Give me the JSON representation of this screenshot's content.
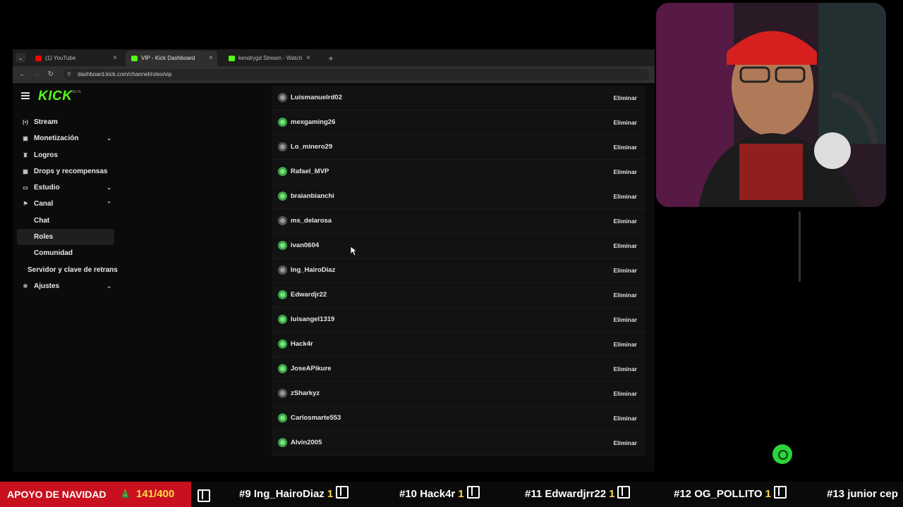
{
  "browser": {
    "tabs": [
      {
        "label": "(1) YouTube",
        "close": "×",
        "favicon_color": "#ff0000"
      },
      {
        "label": "VIP - Kick Dashboard",
        "close": "×",
        "favicon_color": "#53fc18",
        "active": true
      },
      {
        "label": "kendrygd Stream - Watch Live ...",
        "close": "×",
        "favicon_color": "#53fc18"
      }
    ],
    "new_tab": "+",
    "url": "dashboard.kick.com/channel/roles/vip"
  },
  "kick": {
    "logo": "KICK",
    "beta": "BETA"
  },
  "sidebar": {
    "items": [
      {
        "label": "Stream",
        "icon": "broadcast-icon",
        "chevron": ""
      },
      {
        "label": "Monetización",
        "icon": "wallet-icon",
        "chevron": "⌄"
      },
      {
        "label": "Logros",
        "icon": "trophy-icon",
        "chevron": ""
      },
      {
        "label": "Drops y recompensas",
        "icon": "gift-icon",
        "chevron": ""
      },
      {
        "label": "Estudio",
        "icon": "studio-icon",
        "chevron": "⌄"
      },
      {
        "label": "Canal",
        "icon": "channel-icon",
        "chevron": "⌃"
      },
      {
        "label": "Chat",
        "sub": true
      },
      {
        "label": "Roles",
        "sub": true,
        "active": true
      },
      {
        "label": "Comunidad",
        "sub": true
      },
      {
        "label": "Servidor y clave de retrans",
        "sub": true
      },
      {
        "label": "Ajustes",
        "icon": "gear-icon",
        "chevron": "⌄"
      }
    ]
  },
  "vip_list": {
    "remove_label": "Eliminar",
    "users": [
      "Luismanuelrd02",
      "mexgaming26",
      "Lo_minero29",
      "Rafael_MVP",
      "braianbianchi",
      "ms_delarosa",
      "ivan0604",
      "Ing_HairoDiaz",
      "Edwardjr22",
      "luisangel1319",
      "Hack4r",
      "JoseAPikure",
      "zSharkyz",
      "Carlosmarte553",
      "Alvin2005"
    ]
  },
  "ticker": {
    "promo": "APOYO DE NAVIDAD",
    "promo_icon": "🎄",
    "progress": "141/400",
    "entries": [
      {
        "rank": "#9",
        "name": "Ing_HairoDiaz",
        "value": "1"
      },
      {
        "rank": "#10",
        "name": "Hack4r",
        "value": "1"
      },
      {
        "rank": "#11",
        "name": "Edwardjrr22",
        "value": "1"
      },
      {
        "rank": "#12",
        "name": "OG_POLLITO",
        "value": "1"
      },
      {
        "rank": "#13",
        "name": "junior cep",
        "value": ""
      }
    ]
  },
  "colors": {
    "accent": "#53fc18",
    "ticker_red": "#c8101e",
    "ticker_yellow": "#ffd84a"
  }
}
